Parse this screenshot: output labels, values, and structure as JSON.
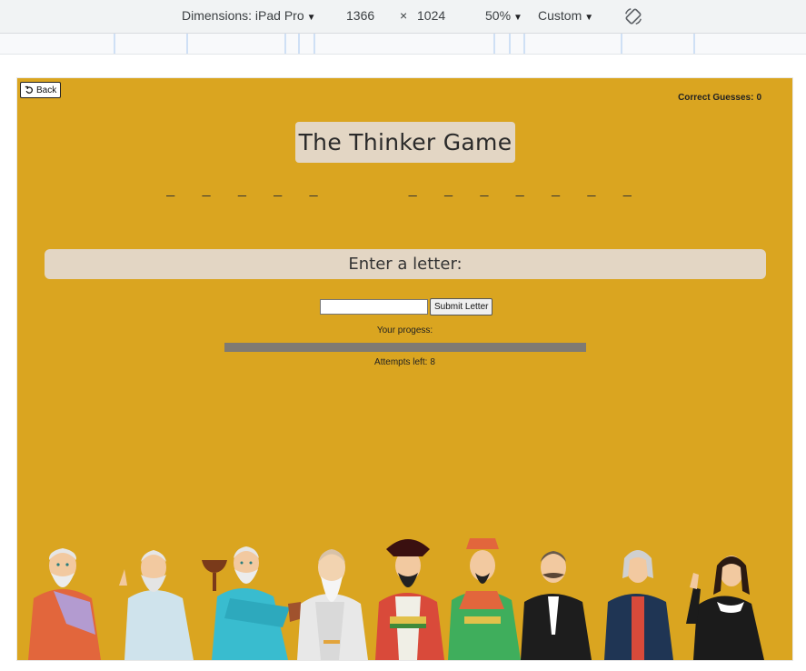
{
  "devtools": {
    "dimensions_label": "Dimensions: iPad Pro",
    "width": "1366",
    "times": "×",
    "height": "1024",
    "zoom": "50%",
    "throttle": "Custom",
    "rotate_icon": "rotate-icon"
  },
  "game": {
    "back_label": "Back",
    "correct_label": "Correct Guesses:",
    "correct_count": "0",
    "title": "The Thinker Game",
    "word_blanks": "_ _ _ _ _     _ _ _ _ _ _ _",
    "prompt": "Enter a letter:",
    "letter_input_value": "",
    "submit_label": "Submit Letter",
    "progress_label": "Your progess:",
    "progress_fraction": 0,
    "attempts_label": "Attempts left:",
    "attempts_count": "8"
  },
  "colors": {
    "viewport_bg": "#daa520",
    "panel_bg": "#e3d6c4",
    "progress_track": "#7f7a72"
  }
}
